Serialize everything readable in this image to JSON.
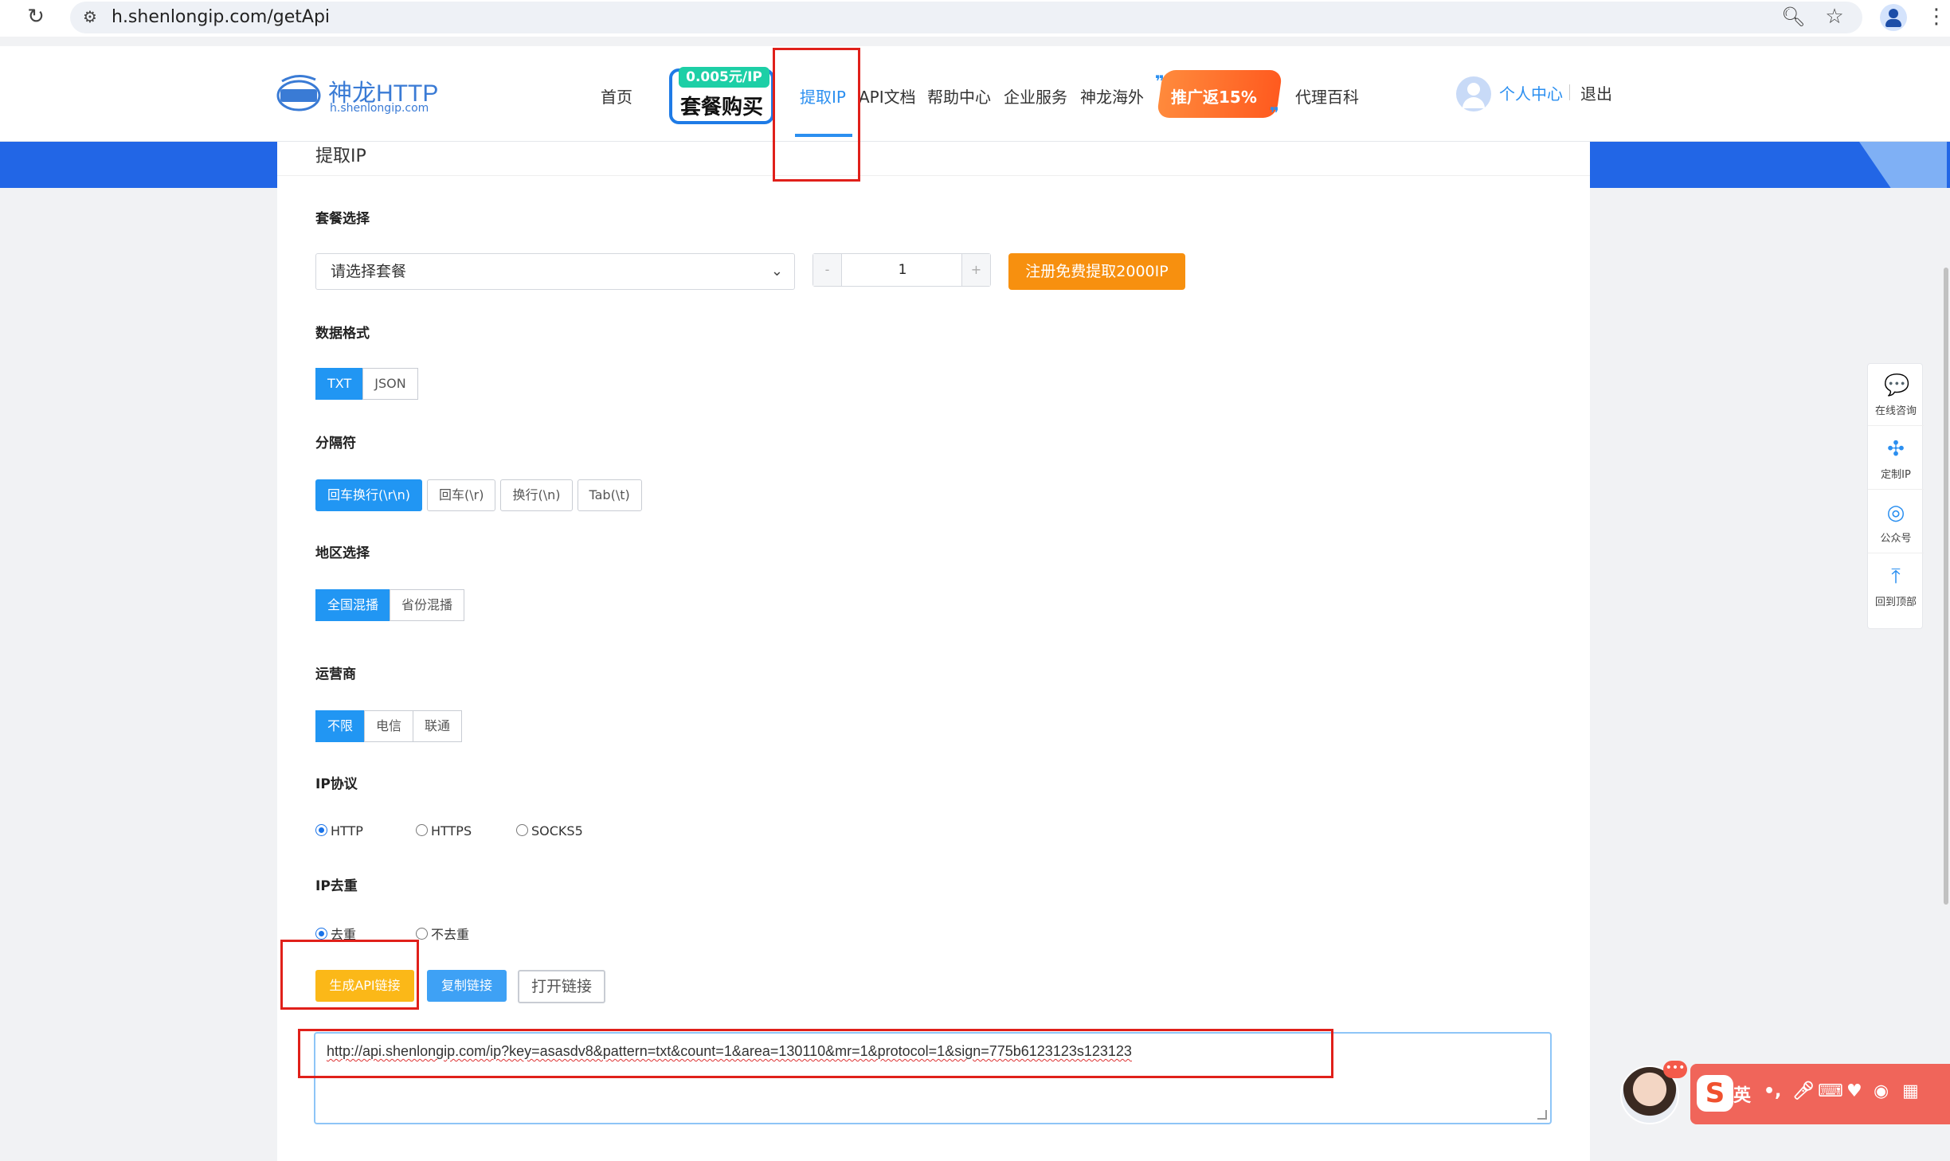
{
  "browser": {
    "url": "h.shenlongip.com/getApi",
    "reload_glyph": "↻",
    "icons": [
      "reload-icon",
      "site-info-icon",
      "zoom-icon",
      "star-icon",
      "profile-icon",
      "menu-icon"
    ]
  },
  "header": {
    "logo_text": "神龙HTTP",
    "logo_sub": "h.shenlongip.com",
    "logo_badge_text": "HTTP",
    "nav": {
      "home": "首页",
      "package_price": "0.005元/IP",
      "package_label": "套餐购买",
      "extract_ip": "提取IP",
      "api_docs": "API文档",
      "help": "帮助中心",
      "enterprise": "企业服务",
      "overseas": "神龙海外",
      "promo": "推广返15%",
      "encyclopedia": "代理百科"
    },
    "user_center": "个人中心",
    "logout": "退出"
  },
  "form": {
    "title": "提取IP",
    "package_section": "套餐选择",
    "package_placeholder": "请选择套餐",
    "quantity": "1",
    "minus": "-",
    "plus": "+",
    "register_button": "注册免费提取2000IP",
    "format_section": "数据格式",
    "formats": [
      "TXT",
      "JSON"
    ],
    "separator_section": "分隔符",
    "separators": [
      "回车换行(\\r\\n)",
      "回车(\\r)",
      "换行(\\n)",
      "Tab(\\t)"
    ],
    "region_section": "地区选择",
    "regions": [
      "全国混播",
      "省份混播"
    ],
    "carrier_section": "运营商",
    "carriers": [
      "不限",
      "电信",
      "联通"
    ],
    "protocol_section": "IP协议",
    "protocols": [
      "HTTP",
      "HTTPS",
      "SOCKS5"
    ],
    "dedup_section": "IP去重",
    "dedup_options": [
      "去重",
      "不去重"
    ],
    "generate_button": "生成API链接",
    "copy_button": "复制链接",
    "open_button": "打开链接",
    "api_url": "http://api.shenlongip.com/ip?key=asasdv8&pattern=txt&count=1&area=130110&mr=1&protocol=1&sign=775b6123123s123123"
  },
  "sidebar_float": {
    "items": [
      {
        "label": "在线咨询",
        "glyph": "💬"
      },
      {
        "label": "定制IP",
        "glyph": "✣"
      },
      {
        "label": "公众号",
        "glyph": "◎"
      },
      {
        "label": "回到顶部",
        "glyph": "⤒"
      }
    ]
  },
  "ime": {
    "logo": "S",
    "lang": "英",
    "punct": "•,",
    "badge": "•••"
  },
  "colors": {
    "primary": "#2196f3",
    "orange": "#f7900f",
    "yellow": "#fbb818",
    "highlight": "#e0201a",
    "banner": "#2266e6"
  }
}
